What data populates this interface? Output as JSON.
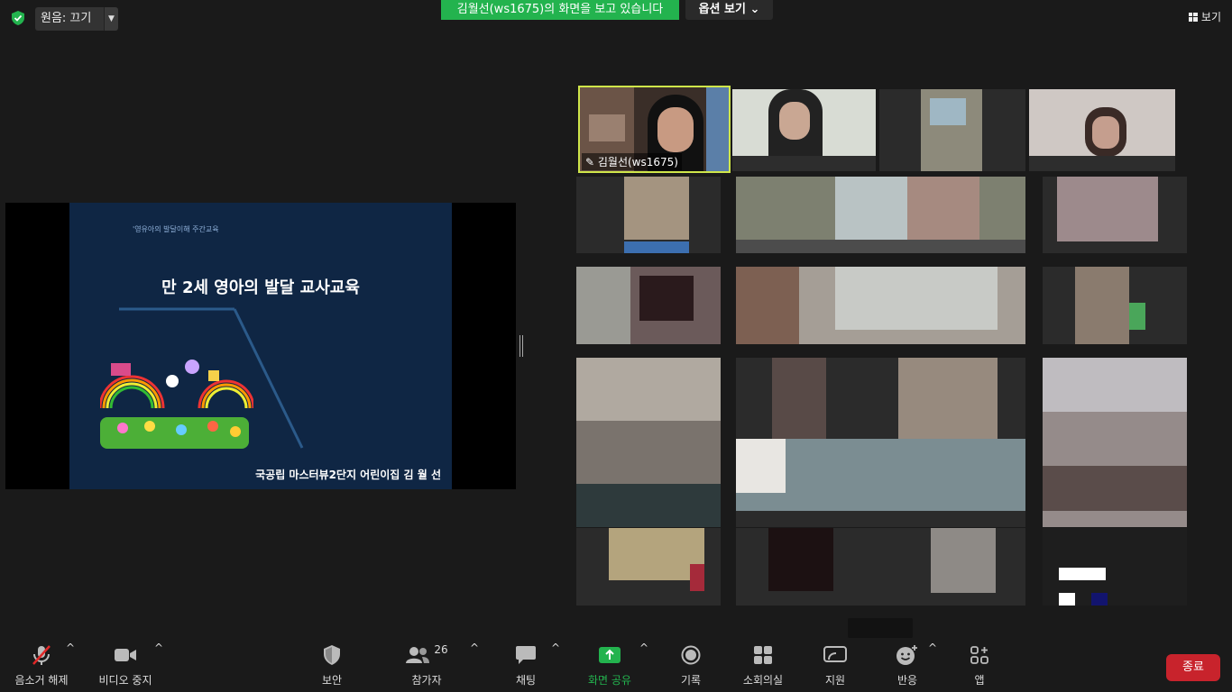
{
  "topbar": {
    "audio_label": "원음: 끄기",
    "share_banner": "김월선(ws1675)의 화면을 보고 있습니다",
    "view_options": "옵션 보기 ⌄",
    "view_label": "보기"
  },
  "slide": {
    "small_caption": "'영유아의 발달이해 주간교육",
    "title": "만 2세 영아의  발달 교사교육",
    "footer": "국공립 마스터뷰2단지 어린이집 김 월 선"
  },
  "participants": {
    "host_name": "김월선(ws1675)",
    "count": "26"
  },
  "toolbar": {
    "mute": "음소거 해제",
    "video": "비디오 중지",
    "security": "보안",
    "participants": "참가자",
    "chat": "채팅",
    "share": "화면 공유",
    "record": "기록",
    "breakout": "소회의실",
    "support": "지원",
    "reactions": "반응",
    "apps": "앱",
    "end": "종료"
  },
  "colors": {
    "share_green": "#23b34e",
    "end_red": "#c8232c",
    "active_speaker": "#cfe64a"
  }
}
